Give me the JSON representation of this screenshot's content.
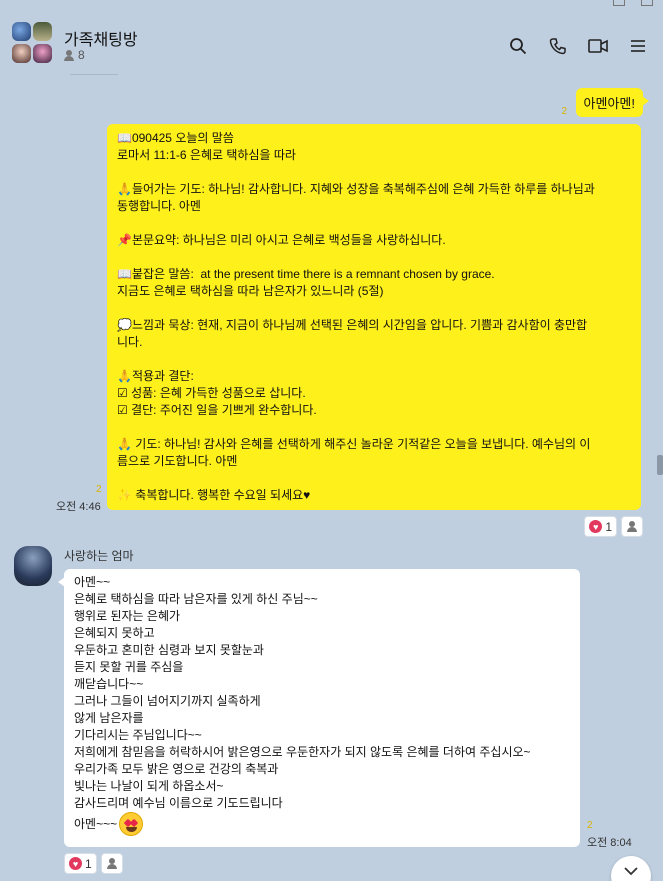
{
  "header": {
    "title": "가족채팅방",
    "member_count": "8"
  },
  "messages": {
    "amen": {
      "text": "아멘아멘!",
      "read": "2"
    },
    "devotion": {
      "read": "2",
      "time": "오전 4:46",
      "lines": [
        "📖090425 오늘의 말씀",
        "로마서 11:1-6 은혜로 택하심을 따라",
        "",
        "🙏들어가는 기도: 하나님! 감사합니다. 지혜와 성장을 축복해주심에 은혜 가득한 하루를 하나님과",
        "동행합니다. 아멘",
        "",
        "📌본문요약: 하나님은 미리 아시고 은혜로 백성들을 사랑하십니다.",
        "",
        "📖붙잡은 말씀:  at the present time there is a remnant chosen by grace.",
        "지금도 은혜로 택하심을 따라 남은자가 있느니라 (5절)",
        "",
        "💭느낌과 묵상: 현재, 지금이 하나님께 선택된 은혜의 시간임을 압니다. 기쁨과 감사함이 충만합",
        "니다.",
        "",
        "🙏적용과 결단:",
        "☑ 성품: 은혜 가득한 성품으로 삽니다.",
        "☑ 결단: 주어진 일을 기쁘게 완수합니다.",
        "",
        "🙏 기도: 하나님! 감사와 은혜를 선택하게 해주신 놀라운 기적같은 오늘을 보냅니다. 예수님의 이",
        "름으로 기도합니다. 아멘",
        "",
        "✨ 축복합니다. 행복한 수요일 되세요♥"
      ],
      "reaction_count": "1"
    },
    "mom": {
      "sender": "사랑하는 엄마",
      "read": "2",
      "time": "오전 8:04",
      "lines": [
        "아멘~~",
        "은혜로 택하심을 따라 남은자를 있게 하신 주님~~",
        "행위로 된자는 은혜가",
        "은혜되지 못하고",
        "우둔하고 혼미한 심령과 보지 못할눈과",
        "듣지 못할 귀를 주심을",
        "깨닫습니다~~",
        "그러나 그들이 넘어지기까지 실족하게",
        "않게 남은자를",
        "기다리시는 주님입니다~~",
        "저희에게 참믿음을 허락하시어 밝은영으로 우둔한자가 되지 않도록 은혜를 더하여 주십시오~",
        "우리가족 모두 밝은 영으로 건강의 축복과",
        "빛나는 나날이 되게 하옵소서~",
        "감사드리며 예수님 이름으로 기도드립니다"
      ],
      "last_line": "아멘~~~",
      "reaction_count": "1"
    }
  },
  "colors": {
    "background": "#bfcfe0",
    "my_bubble": "#fef01b",
    "other_bubble": "#ffffff",
    "heart": "#e23a5e"
  },
  "icons": [
    "search-icon",
    "phone-icon",
    "video-icon",
    "menu-icon",
    "heart-icon",
    "person-icon",
    "chevron-down-icon"
  ]
}
